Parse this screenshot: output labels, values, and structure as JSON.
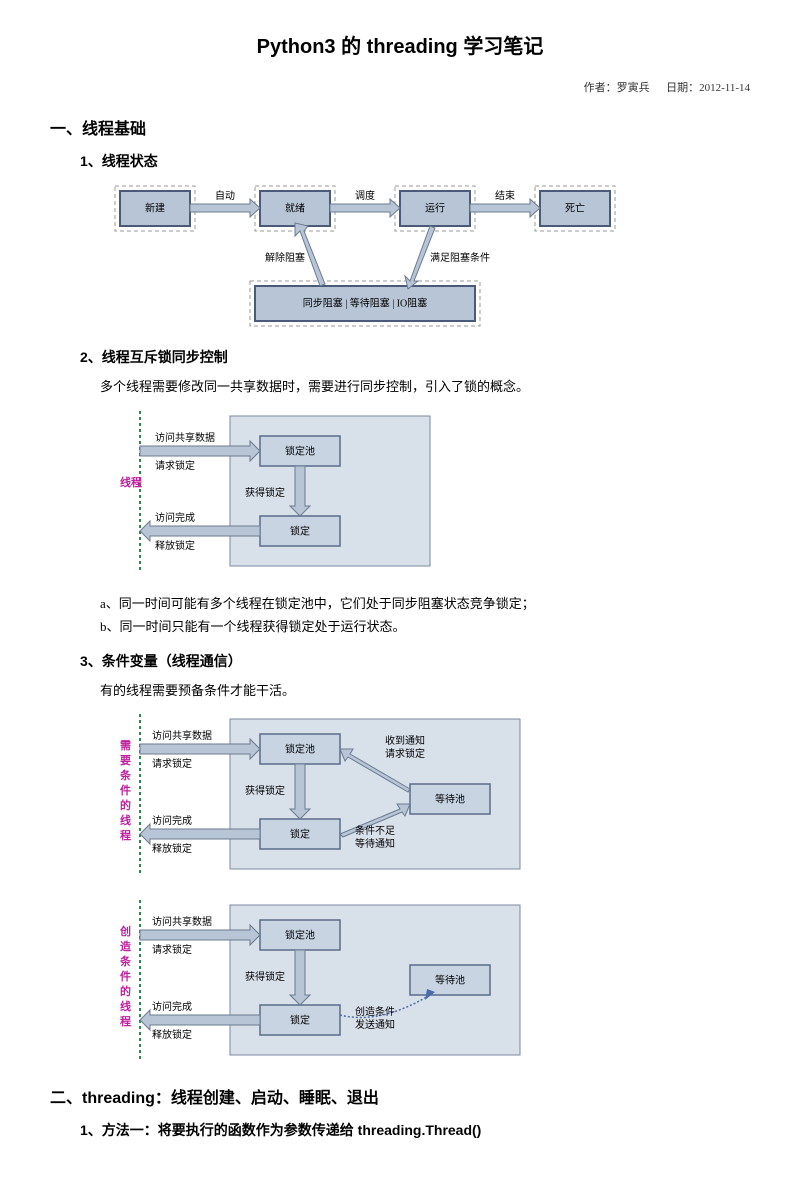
{
  "title": "Python3 的 threading 学习笔记",
  "meta": {
    "author_label": "作者：罗寅兵",
    "date_label": "日期：2012-11-14"
  },
  "sections": {
    "s1": {
      "heading": "一、线程基础",
      "sub1": {
        "heading": "1、线程状态",
        "diagram": {
          "box_new": "新建",
          "box_ready": "就绪",
          "box_run": "运行",
          "box_dead": "死亡",
          "box_block": "同步阻塞 | 等待阻塞 | IO阻塞",
          "lbl_auto": "自动",
          "lbl_sched": "调度",
          "lbl_end": "结束",
          "lbl_unblock": "解除阻塞",
          "lbl_blockcond": "满足阻塞条件"
        }
      },
      "sub2": {
        "heading": "2、线程互斥锁同步控制",
        "para": "多个线程需要修改同一共享数据时，需要进行同步控制，引入了锁的概念。",
        "diagram": {
          "vlabel": "线程",
          "lbl_access": "访问共享数据",
          "lbl_request": "请求锁定",
          "lbl_acquire": "获得锁定",
          "lbl_done": "访问完成",
          "lbl_release": "释放锁定",
          "box_pool": "锁定池",
          "box_lock": "锁定"
        },
        "note_a": "a、同一时间可能有多个线程在锁定池中，它们处于同步阻塞状态竞争锁定；",
        "note_b": "b、同一时间只能有一个线程获得锁定处于运行状态。"
      },
      "sub3": {
        "heading": "3、条件变量（线程通信）",
        "para": "有的线程需要预备条件才能干活。",
        "diagram1": {
          "vlabel": "需要条件的线程",
          "lbl_access": "访问共享数据",
          "lbl_request": "请求锁定",
          "lbl_acquire": "获得锁定",
          "lbl_done": "访问完成",
          "lbl_release": "释放锁定",
          "lbl_notify": "收到通知",
          "lbl_reqlock": "请求锁定",
          "lbl_condno": "条件不足",
          "lbl_waitnotify": "等待通知",
          "box_pool": "锁定池",
          "box_lock": "锁定",
          "box_wait": "等待池"
        },
        "diagram2": {
          "vlabel": "创造条件的线程",
          "lbl_access": "访问共享数据",
          "lbl_request": "请求锁定",
          "lbl_acquire": "获得锁定",
          "lbl_done": "访问完成",
          "lbl_release": "释放锁定",
          "lbl_create": "创造条件",
          "lbl_send": "发送通知",
          "box_pool": "锁定池",
          "box_lock": "锁定",
          "box_wait": "等待池"
        }
      }
    },
    "s2": {
      "heading": "二、threading：线程创建、启动、睡眠、退出",
      "sub1": {
        "heading": "1、方法一：将要执行的函数作为参数传递给 threading.Thread()"
      }
    }
  }
}
